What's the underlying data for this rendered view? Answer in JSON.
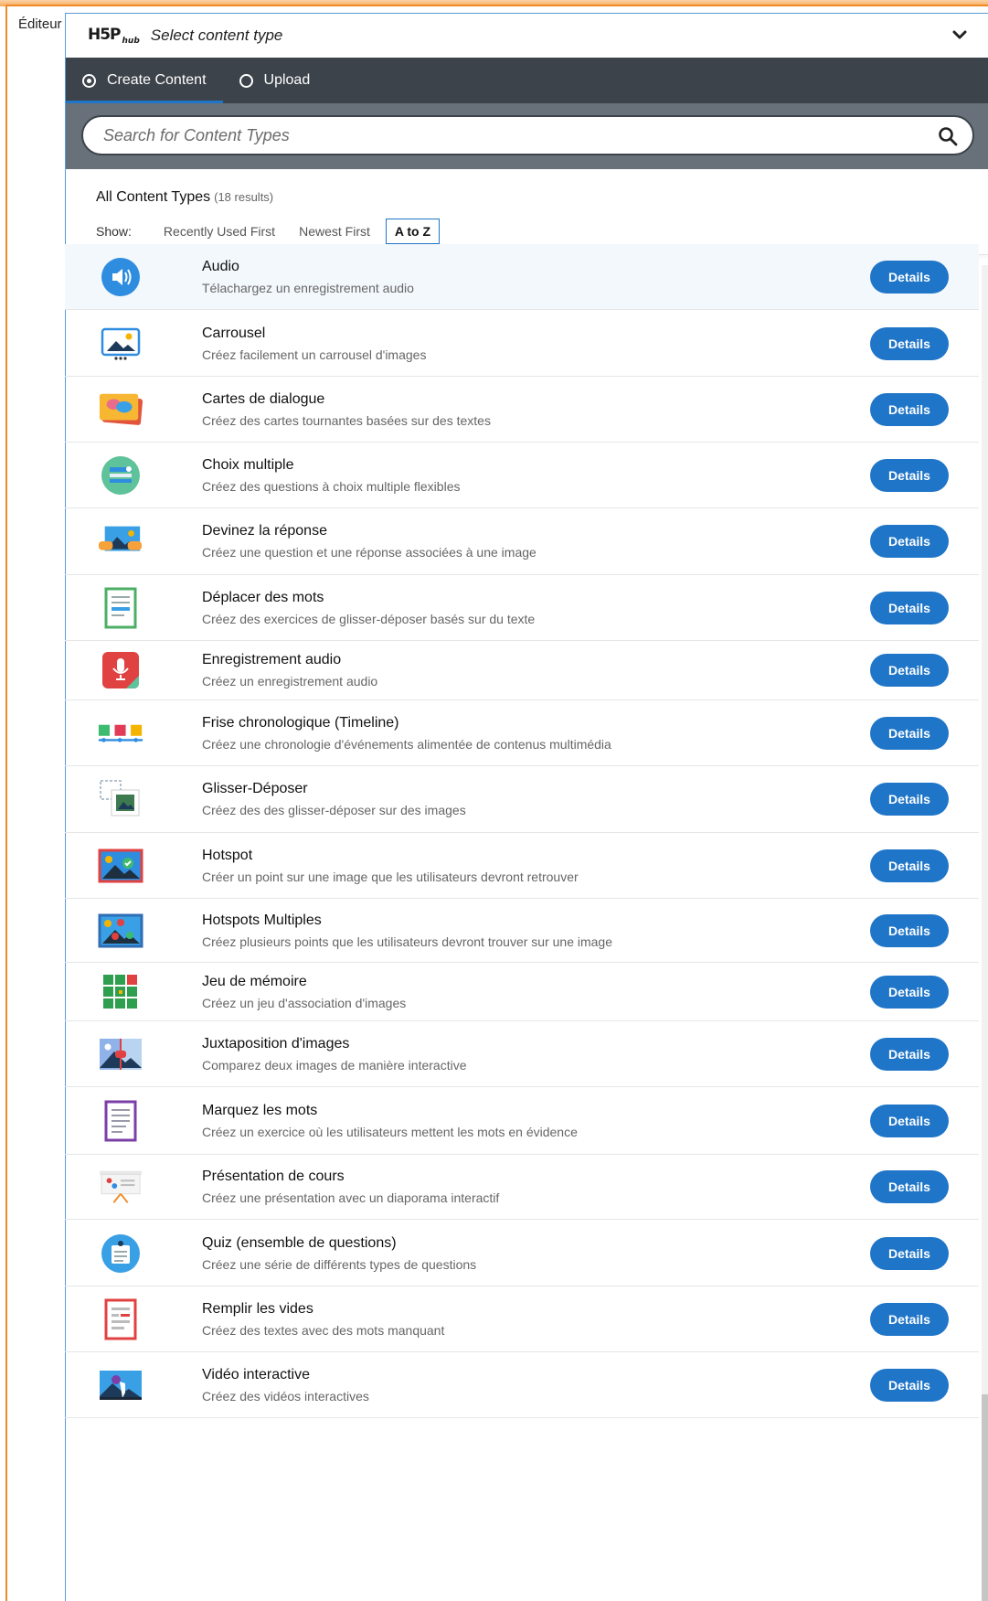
{
  "editor_label": "Éditeur",
  "hub": {
    "logo": "H5P",
    "logo_sub": "hub",
    "title": "Select content type"
  },
  "tabs": [
    {
      "label": "Create Content",
      "selected": true
    },
    {
      "label": "Upload",
      "selected": false
    }
  ],
  "search": {
    "placeholder": "Search for Content Types"
  },
  "filter": {
    "title": "All Content Types",
    "count": "(18 results)",
    "show_label": "Show:",
    "options": [
      "Recently Used First",
      "Newest First",
      "A to Z"
    ],
    "selected": "A to Z"
  },
  "details_label": "Details",
  "items": [
    {
      "title": "Audio",
      "desc": "Télachargez un enregistrement audio",
      "icon": "audio-icon"
    },
    {
      "title": "Carrousel",
      "desc": "Créez facilement un carrousel d'images",
      "icon": "carousel-icon"
    },
    {
      "title": "Cartes de dialogue",
      "desc": "Créez des cartes tournantes basées sur des textes",
      "icon": "dialog-cards-icon"
    },
    {
      "title": "Choix multiple",
      "desc": "Créez des questions à choix multiple flexibles",
      "icon": "multiple-choice-icon"
    },
    {
      "title": "Devinez la réponse",
      "desc": "Créez une question et une réponse associées à une image",
      "icon": "guess-answer-icon"
    },
    {
      "title": "Déplacer des mots",
      "desc": "Créez des exercices de glisser-déposer basés sur du texte",
      "icon": "drag-text-icon"
    },
    {
      "title": "Enregistrement audio",
      "desc": "Créez un enregistrement audio",
      "icon": "audio-recorder-icon"
    },
    {
      "title": "Frise chronologique (Timeline)",
      "desc": "Créez une chronologie d'événements alimentée de contenus multimédia",
      "icon": "timeline-icon"
    },
    {
      "title": "Glisser-Déposer",
      "desc": "Créez des des glisser-déposer sur des images",
      "icon": "drag-drop-icon"
    },
    {
      "title": "Hotspot",
      "desc": "Créer un point sur une image que les utilisateurs devront retrouver",
      "icon": "hotspot-icon"
    },
    {
      "title": "Hotspots Multiples",
      "desc": "Créez plusieurs points que les utilisateurs devront trouver sur une image",
      "icon": "multiple-hotspots-icon"
    },
    {
      "title": "Jeu de mémoire",
      "desc": "Créez un jeu d'association d'images",
      "icon": "memory-game-icon"
    },
    {
      "title": "Juxtaposition d'images",
      "desc": "Comparez deux images de manière interactive",
      "icon": "image-juxtaposition-icon"
    },
    {
      "title": "Marquez les mots",
      "desc": "Créez un exercice où les utilisateurs mettent les mots en évidence",
      "icon": "mark-words-icon"
    },
    {
      "title": "Présentation de cours",
      "desc": "Créez une présentation avec un diaporama interactif",
      "icon": "course-presentation-icon"
    },
    {
      "title": "Quiz (ensemble de questions)",
      "desc": "Créez une série de différents types de questions",
      "icon": "quiz-icon"
    },
    {
      "title": "Remplir les vides",
      "desc": "Créez des textes avec des mots manquant",
      "icon": "fill-blanks-icon"
    },
    {
      "title": "Vidéo interactive",
      "desc": "Créez des vidéos interactives",
      "icon": "interactive-video-icon"
    }
  ],
  "colors": {
    "accent": "#1f75c8",
    "frame": "#f08a24",
    "tabbar": "#3c434a",
    "searchbar": "#68717a"
  }
}
